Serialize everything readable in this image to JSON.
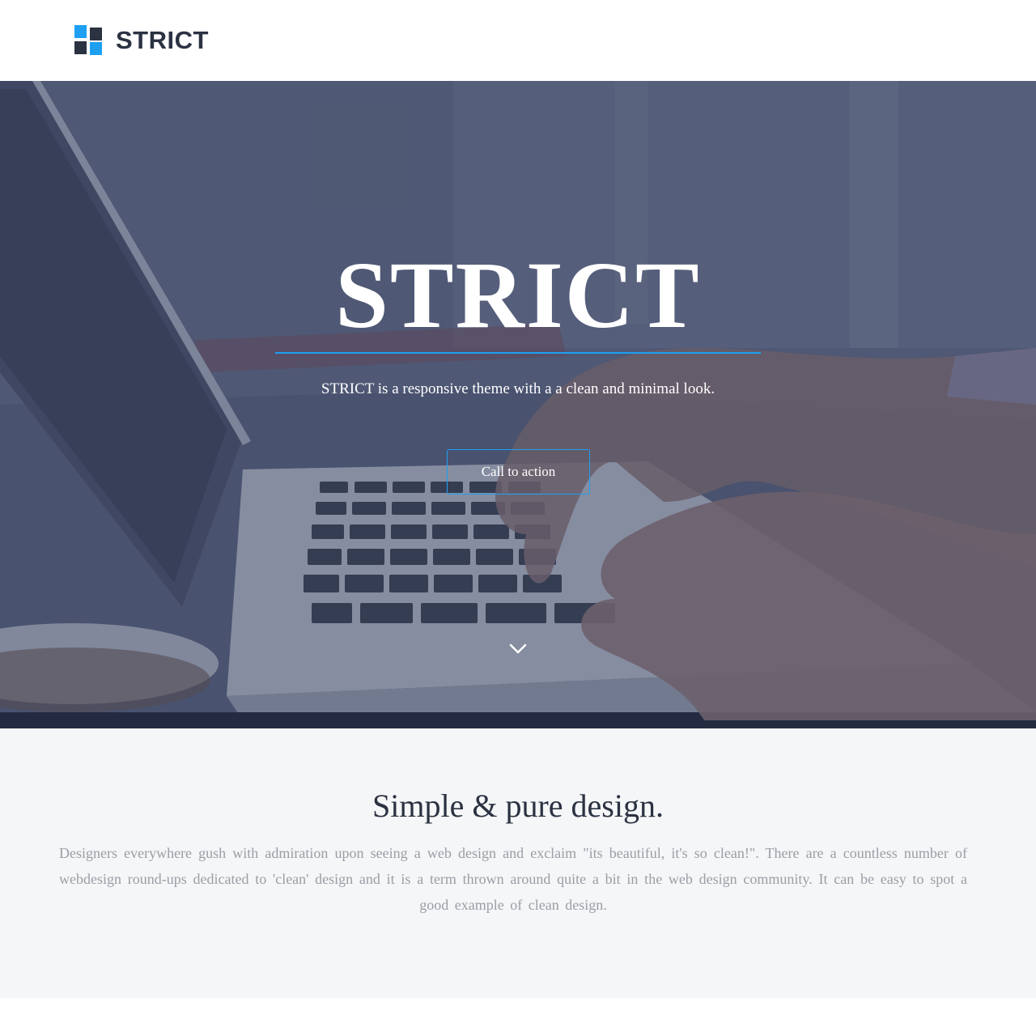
{
  "header": {
    "brand_name": "STRICT",
    "logo_icon": "four-squares-logo-icon"
  },
  "hero": {
    "title": "STRICT",
    "subtitle": "STRICT is a responsive theme with a a clean and minimal look.",
    "cta_label": "Call to action",
    "scroll_icon": "chevron-down-icon"
  },
  "intro": {
    "title": "Simple & pure design.",
    "text": "Designers everywhere gush with admiration upon seeing a web design and exclaim \"its beautiful, it's so clean!\". There are a countless number of webdesign round-ups dedicated to 'clean' design and it is a term thrown around quite a bit in the web design community. It can be easy to spot a good example of clean design."
  },
  "colors": {
    "accent": "#1e9ff2",
    "dark": "#2b3242",
    "section_bg": "#f4f6f7",
    "body_text": "#9a9ea6"
  }
}
